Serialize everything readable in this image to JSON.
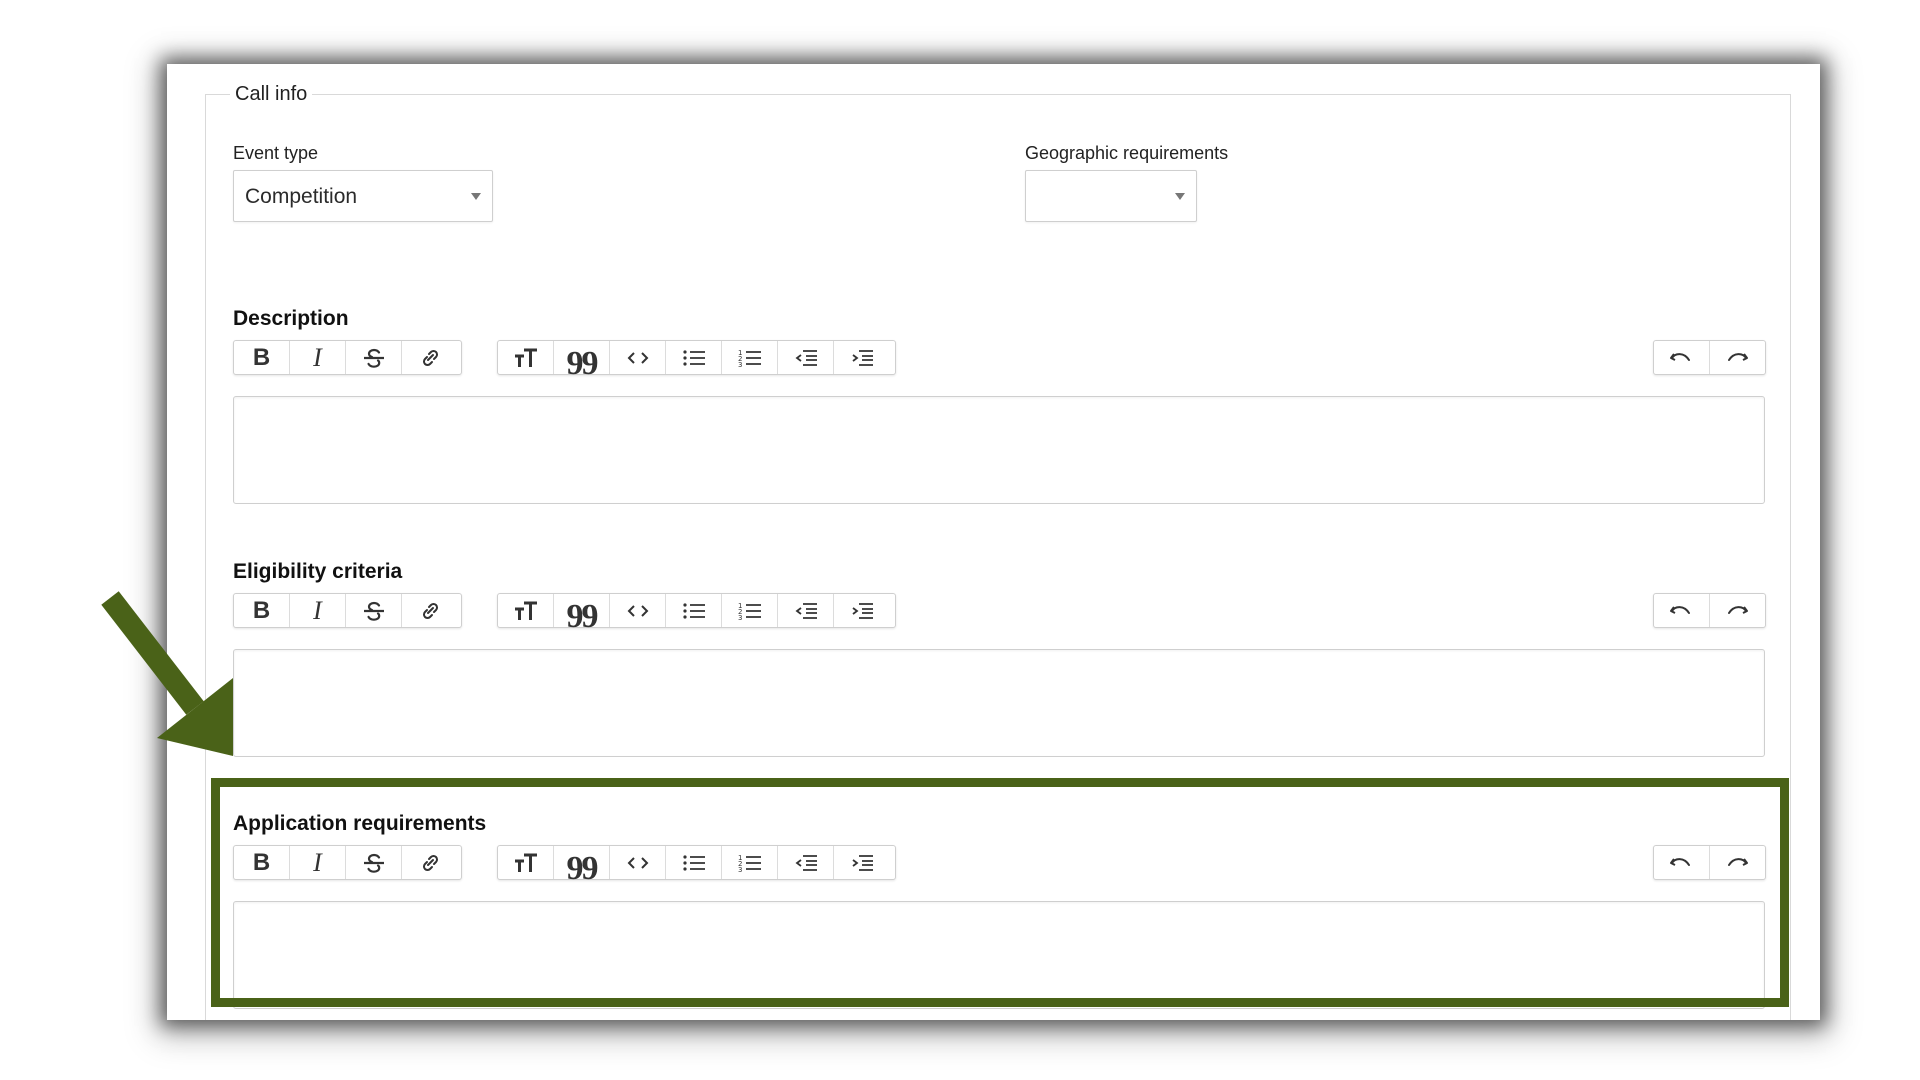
{
  "form": {
    "legend": "Call info",
    "event_type": {
      "label": "Event type",
      "value": "Competition"
    },
    "geographic": {
      "label": "Geographic requirements",
      "value": ""
    },
    "editors": [
      {
        "title": "Description"
      },
      {
        "title": "Eligibility criteria"
      },
      {
        "title": "Application requirements"
      }
    ]
  },
  "toolbar": {
    "format_group": [
      "bold",
      "italic",
      "strikethrough",
      "link"
    ],
    "block_group": [
      "heading",
      "quote",
      "code",
      "bulleted-list",
      "numbered-list",
      "outdent",
      "indent"
    ],
    "history_group": [
      "undo",
      "redo"
    ]
  },
  "annotation": {
    "highlight_color": "#4a6218",
    "arrow_color": "#4a6218"
  }
}
